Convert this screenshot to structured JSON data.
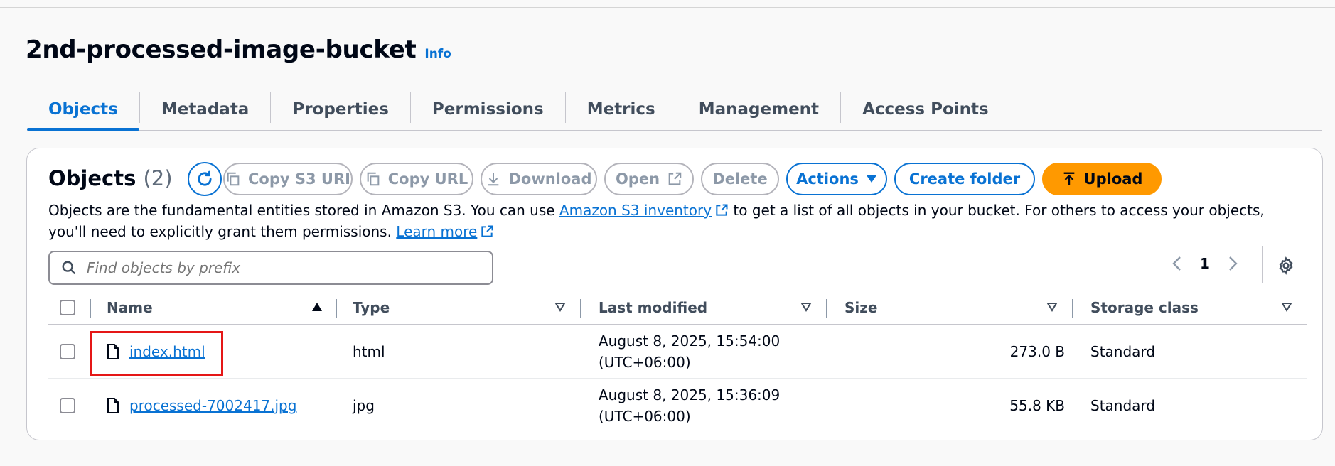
{
  "bucket": {
    "title": "2nd-processed-image-bucket",
    "info_label": "Info"
  },
  "tabs": [
    {
      "label": "Objects",
      "active": true
    },
    {
      "label": "Metadata"
    },
    {
      "label": "Properties"
    },
    {
      "label": "Permissions"
    },
    {
      "label": "Metrics"
    },
    {
      "label": "Management"
    },
    {
      "label": "Access Points"
    }
  ],
  "objects": {
    "heading": "Objects",
    "count": "(2)",
    "buttons": {
      "copy_s3_uri": "Copy S3 URI",
      "copy_url": "Copy URL",
      "download": "Download",
      "open": "Open",
      "delete": "Delete",
      "actions": "Actions",
      "create_folder": "Create folder",
      "upload": "Upload"
    },
    "description": {
      "part1": "Objects are the fundamental entities stored in Amazon S3. You can use ",
      "link1": "Amazon S3 inventory",
      "part2": " to get a list of all objects in your bucket. For others to access your objects, you'll need to explicitly grant them permissions. ",
      "link2": "Learn more"
    },
    "search_placeholder": "Find objects by prefix",
    "page_number": "1",
    "columns": {
      "name": "Name",
      "type": "Type",
      "last_modified": "Last modified",
      "size": "Size",
      "storage_class": "Storage class"
    },
    "rows": [
      {
        "name": "index.html",
        "type": "html",
        "modified_date": "August 8, 2025, 15:54:00",
        "modified_tz": "(UTC+06:00)",
        "size": "273.0 B",
        "storage_class": "Standard"
      },
      {
        "name": "processed-7002417.jpg",
        "type": "jpg",
        "modified_date": "August 8, 2025, 15:36:09",
        "modified_tz": "(UTC+06:00)",
        "size": "55.8 KB",
        "storage_class": "Standard"
      }
    ]
  },
  "colors": {
    "accent": "#0972d3",
    "upload": "#ff9900",
    "highlight": "#e51717"
  }
}
